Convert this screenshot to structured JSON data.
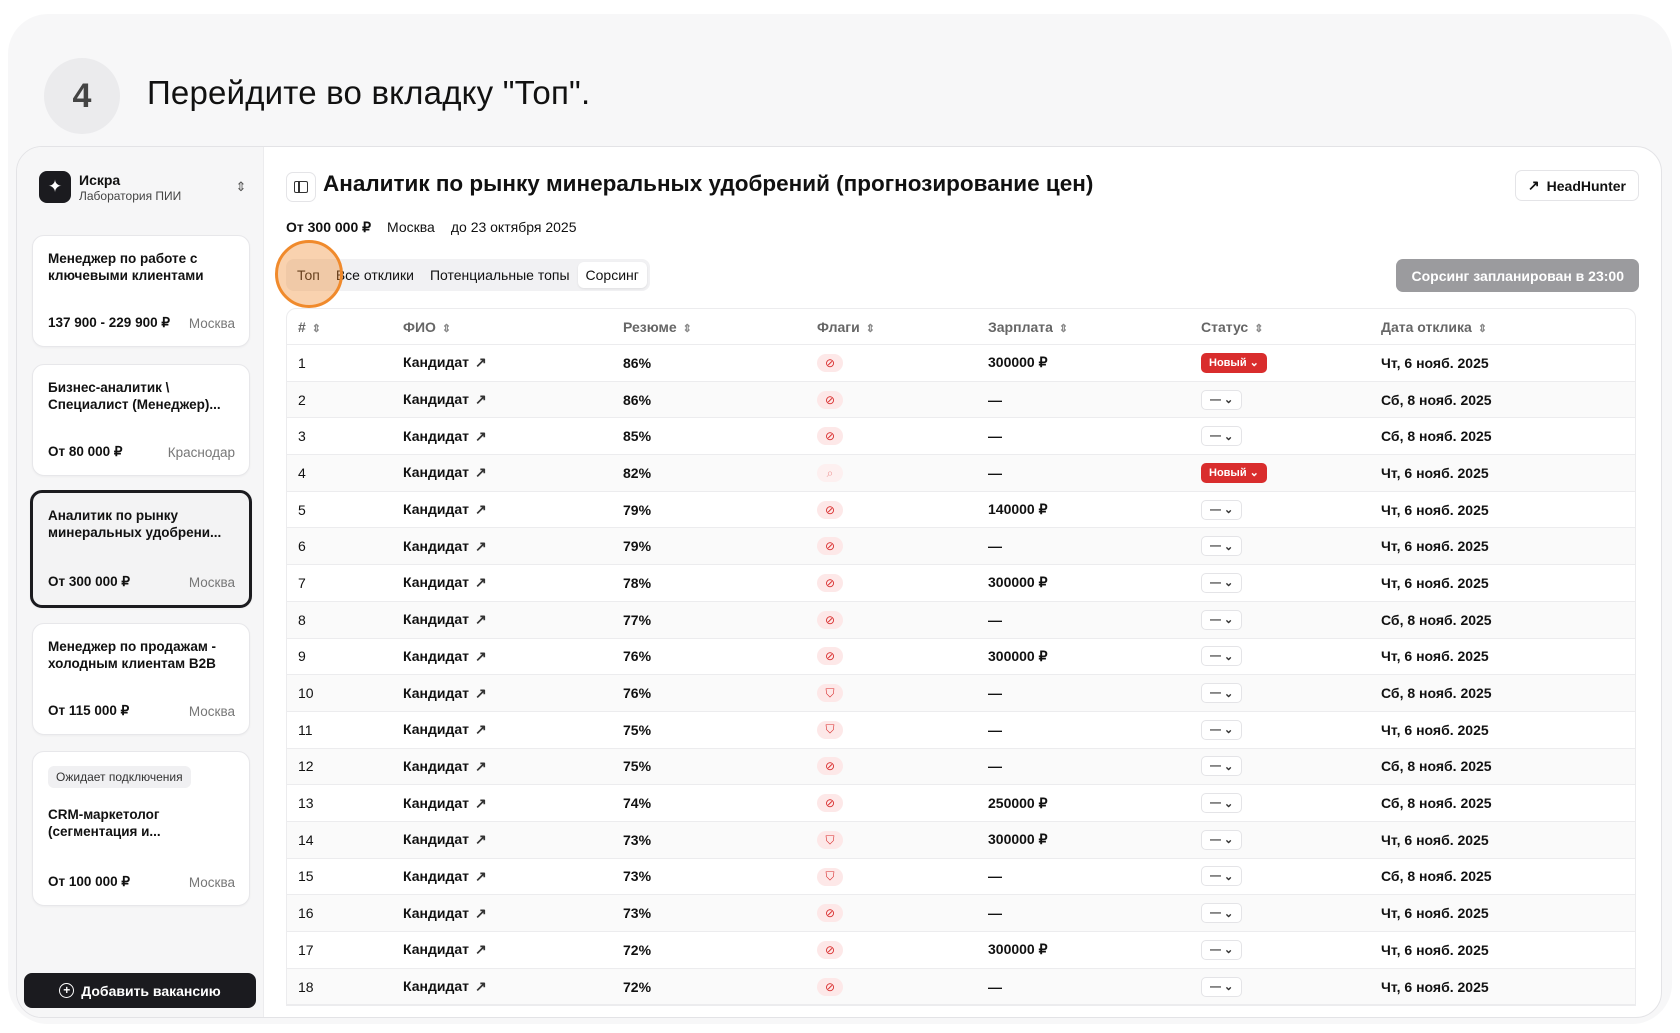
{
  "step": {
    "number": "4",
    "text": "Перейдите во вкладку \"Топ\"."
  },
  "sidebar": {
    "org_name": "Искра",
    "org_sub": "Лаборатория ПИИ",
    "vacancies": [
      {
        "title": "Менеджер по работе с ключевыми клиентами",
        "salary": "137 900 - 229 900 ₽",
        "city": "Москва"
      },
      {
        "title": "Бизнес-аналитик \\ Специалист (Менеджер)...",
        "salary": "От 80 000 ₽",
        "city": "Краснодар"
      },
      {
        "title": "Аналитик по рынку минеральных удобрени...",
        "salary": "От 300 000 ₽",
        "city": "Москва"
      },
      {
        "title": "Менеджер по продажам - холодным клиентам B2B",
        "salary": "От 115 000 ₽",
        "city": "Москва"
      },
      {
        "badge": "Ожидает подключения",
        "title": "CRM-маркетолог (сегментация и...",
        "salary": "От 100 000 ₽",
        "city": "Москва"
      }
    ],
    "add_button": "Добавить вакансию"
  },
  "header": {
    "title": "Аналитик по рынку минеральных удобрений (прогнозирование цен)",
    "headhunter_label": "HeadHunter",
    "salary": "От 300 000 ₽",
    "city": "Москва",
    "deadline": "до 23 октября 2025"
  },
  "tabs": [
    "Топ",
    "Все отклики",
    "Потенциальные топы",
    "Сорсинг"
  ],
  "sourcing_button": "Сорсинг запланирован в 23:00",
  "table": {
    "columns": [
      "#",
      "ФИО",
      "Резюме",
      "Флаги",
      "Зарплата",
      "Статус",
      "Дата отклика"
    ],
    "rows": [
      {
        "n": "1",
        "name": "Кандидат",
        "resume": "86%",
        "flag": "ban",
        "salary": "300000 ₽",
        "status": "Новый",
        "date": "Чт, 6 нояб. 2025"
      },
      {
        "n": "2",
        "name": "Кандидат",
        "resume": "86%",
        "flag": "ban",
        "salary": "—",
        "status": "—",
        "date": "Сб, 8 нояб. 2025"
      },
      {
        "n": "3",
        "name": "Кандидат",
        "resume": "85%",
        "flag": "ban",
        "salary": "—",
        "status": "—",
        "date": "Сб, 8 нояб. 2025"
      },
      {
        "n": "4",
        "name": "Кандидат",
        "resume": "82%",
        "flag": "search",
        "salary": "—",
        "status": "Новый",
        "date": "Чт, 6 нояб. 2025"
      },
      {
        "n": "5",
        "name": "Кандидат",
        "resume": "79%",
        "flag": "ban",
        "salary": "140000 ₽",
        "status": "—",
        "date": "Чт, 6 нояб. 2025"
      },
      {
        "n": "6",
        "name": "Кандидат",
        "resume": "79%",
        "flag": "ban",
        "salary": "—",
        "status": "—",
        "date": "Чт, 6 нояб. 2025"
      },
      {
        "n": "7",
        "name": "Кандидат",
        "resume": "78%",
        "flag": "ban",
        "salary": "300000 ₽",
        "status": "—",
        "date": "Чт, 6 нояб. 2025"
      },
      {
        "n": "8",
        "name": "Кандидат",
        "resume": "77%",
        "flag": "ban",
        "salary": "—",
        "status": "—",
        "date": "Сб, 8 нояб. 2025"
      },
      {
        "n": "9",
        "name": "Кандидат",
        "resume": "76%",
        "flag": "ban",
        "salary": "300000 ₽",
        "status": "—",
        "date": "Чт, 6 нояб. 2025"
      },
      {
        "n": "10",
        "name": "Кандидат",
        "resume": "76%",
        "flag": "shield",
        "salary": "—",
        "status": "—",
        "date": "Сб, 8 нояб. 2025"
      },
      {
        "n": "11",
        "name": "Кандидат",
        "resume": "75%",
        "flag": "shield",
        "salary": "—",
        "status": "—",
        "date": "Чт, 6 нояб. 2025"
      },
      {
        "n": "12",
        "name": "Кандидат",
        "resume": "75%",
        "flag": "ban",
        "salary": "—",
        "status": "—",
        "date": "Сб, 8 нояб. 2025"
      },
      {
        "n": "13",
        "name": "Кандидат",
        "resume": "74%",
        "flag": "ban",
        "salary": "250000 ₽",
        "status": "—",
        "date": "Сб, 8 нояб. 2025"
      },
      {
        "n": "14",
        "name": "Кандидат",
        "resume": "73%",
        "flag": "shield",
        "salary": "300000 ₽",
        "status": "—",
        "date": "Чт, 6 нояб. 2025"
      },
      {
        "n": "15",
        "name": "Кандидат",
        "resume": "73%",
        "flag": "shield",
        "salary": "—",
        "status": "—",
        "date": "Сб, 8 нояб. 2025"
      },
      {
        "n": "16",
        "name": "Кандидат",
        "resume": "73%",
        "flag": "ban",
        "salary": "—",
        "status": "—",
        "date": "Чт, 6 нояб. 2025"
      },
      {
        "n": "17",
        "name": "Кандидат",
        "resume": "72%",
        "flag": "ban",
        "salary": "300000 ₽",
        "status": "—",
        "date": "Чт, 6 нояб. 2025"
      },
      {
        "n": "18",
        "name": "Кандидат",
        "resume": "72%",
        "flag": "ban",
        "salary": "—",
        "status": "—",
        "date": "Чт, 6 нояб. 2025"
      }
    ]
  },
  "colors": {
    "accent": "#1b1b1f",
    "status_new": "#d92d2d",
    "highlight": "#f08a2c",
    "flag": "#d92d2d"
  }
}
